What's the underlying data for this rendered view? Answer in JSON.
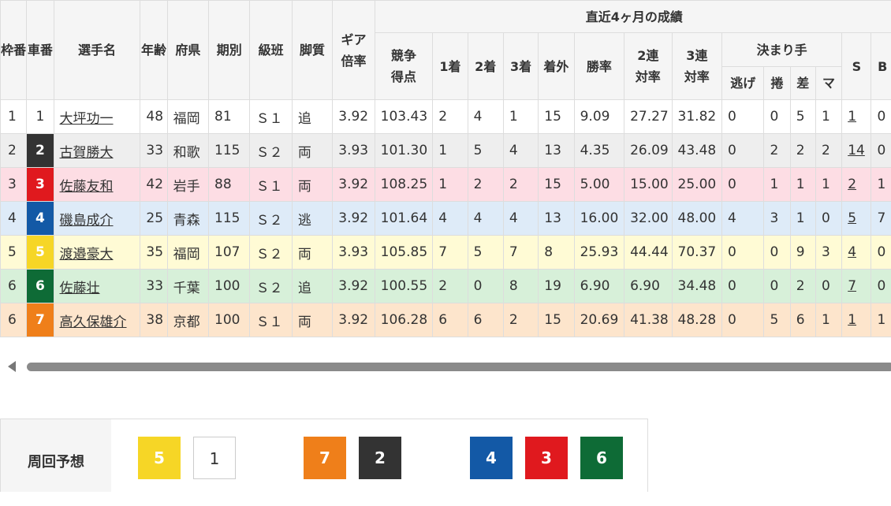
{
  "header": {
    "waku": "枠番",
    "sha": "車番",
    "name": "選手名",
    "age": "年齢",
    "pref": "府県",
    "term": "期別",
    "class": "級班",
    "style": "脚質",
    "gear": "ギア倍率",
    "recent": "直近4ヶ月の成績",
    "score": "競争得点",
    "first": "1着",
    "second": "2着",
    "third": "3着",
    "out": "着外",
    "win_rate": "勝率",
    "top2": "2連対率",
    "top3": "3連対率",
    "kimarite": "決まり手",
    "nige": "逃げ",
    "makuri": "捲",
    "sashi": "差",
    "mark": "マ",
    "s": "S",
    "b": "B"
  },
  "rows": [
    {
      "waku": "1",
      "car": "1",
      "name": "大坪功一",
      "age": "48",
      "pref": "福岡",
      "term": "81",
      "class": "Ｓ１",
      "style": "追",
      "gear": "3.92",
      "score": "103.43",
      "first": "2",
      "second": "4",
      "third": "1",
      "out": "15",
      "win": "9.09",
      "top2": "27.27",
      "top3": "31.82",
      "nige": "0",
      "makuri": "0",
      "sashi": "5",
      "mark": "1",
      "s": "1",
      "b": "0"
    },
    {
      "waku": "2",
      "car": "2",
      "name": "古賀勝大",
      "age": "33",
      "pref": "和歌",
      "term": "115",
      "class": "Ｓ２",
      "style": "両",
      "gear": "3.93",
      "score": "101.30",
      "first": "1",
      "second": "5",
      "third": "4",
      "out": "13",
      "win": "4.35",
      "top2": "26.09",
      "top3": "43.48",
      "nige": "0",
      "makuri": "2",
      "sashi": "2",
      "mark": "2",
      "s": "14",
      "b": "0"
    },
    {
      "waku": "3",
      "car": "3",
      "name": "佐藤友和",
      "age": "42",
      "pref": "岩手",
      "term": "88",
      "class": "Ｓ１",
      "style": "両",
      "gear": "3.92",
      "score": "108.25",
      "first": "1",
      "second": "2",
      "third": "2",
      "out": "15",
      "win": "5.00",
      "top2": "15.00",
      "top3": "25.00",
      "nige": "0",
      "makuri": "1",
      "sashi": "1",
      "mark": "1",
      "s": "2",
      "b": "1"
    },
    {
      "waku": "4",
      "car": "4",
      "name": "磯島成介",
      "age": "25",
      "pref": "青森",
      "term": "115",
      "class": "Ｓ２",
      "style": "逃",
      "gear": "3.92",
      "score": "101.64",
      "first": "4",
      "second": "4",
      "third": "4",
      "out": "13",
      "win": "16.00",
      "top2": "32.00",
      "top3": "48.00",
      "nige": "4",
      "makuri": "3",
      "sashi": "1",
      "mark": "0",
      "s": "5",
      "b": "7"
    },
    {
      "waku": "5",
      "car": "5",
      "name": "渡邉豪大",
      "age": "35",
      "pref": "福岡",
      "term": "107",
      "class": "Ｓ２",
      "style": "両",
      "gear": "3.93",
      "score": "105.85",
      "first": "7",
      "second": "5",
      "third": "7",
      "out": "8",
      "win": "25.93",
      "top2": "44.44",
      "top3": "70.37",
      "nige": "0",
      "makuri": "0",
      "sashi": "9",
      "mark": "3",
      "s": "4",
      "b": "0"
    },
    {
      "waku": "6",
      "car": "6",
      "name": "佐藤壮",
      "age": "33",
      "pref": "千葉",
      "term": "100",
      "class": "Ｓ２",
      "style": "追",
      "gear": "3.92",
      "score": "100.55",
      "first": "2",
      "second": "0",
      "third": "8",
      "out": "19",
      "win": "6.90",
      "top2": "6.90",
      "top3": "34.48",
      "nige": "0",
      "makuri": "0",
      "sashi": "2",
      "mark": "0",
      "s": "7",
      "b": "0"
    },
    {
      "waku": "6",
      "car": "7",
      "name": "高久保雄介",
      "age": "38",
      "pref": "京都",
      "term": "100",
      "class": "Ｓ１",
      "style": "両",
      "gear": "3.92",
      "score": "106.28",
      "first": "6",
      "second": "6",
      "third": "2",
      "out": "15",
      "win": "20.69",
      "top2": "41.38",
      "top3": "48.28",
      "nige": "0",
      "makuri": "5",
      "sashi": "6",
      "mark": "1",
      "s": "1",
      "b": "1"
    }
  ],
  "car_colors": {
    "1": {
      "bg": "#ffffff",
      "fg": "#333333"
    },
    "2": {
      "bg": "#333333",
      "fg": "#ffffff"
    },
    "3": {
      "bg": "#e0191e",
      "fg": "#ffffff"
    },
    "4": {
      "bg": "#1359a6",
      "fg": "#ffffff"
    },
    "5": {
      "bg": "#f6d626",
      "fg": "#ffffff"
    },
    "6": {
      "bg": "#0e6b36",
      "fg": "#ffffff"
    },
    "7": {
      "bg": "#ef7f1a",
      "fg": "#ffffff"
    }
  },
  "forecast": {
    "label": "周回予想",
    "order": [
      "5",
      "1",
      "7",
      "2",
      "4",
      "3",
      "6"
    ]
  }
}
